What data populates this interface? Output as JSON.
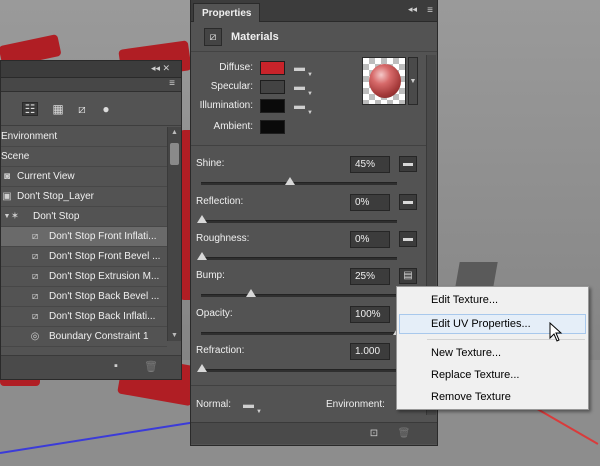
{
  "scene": {
    "red": "#b01e24",
    "floor_axis_blue": "#3b3bd9",
    "floor_axis_red": "#d93b3b"
  },
  "panel3d": {
    "controls": "◂◂ ✕",
    "menu_icon": "≡",
    "tree": [
      {
        "label": "Environment",
        "icon": "none",
        "indent": 0
      },
      {
        "label": "Scene",
        "icon": "none",
        "indent": 0
      },
      {
        "label": "Current View",
        "icon": "camera-icon",
        "indent": 1
      },
      {
        "label": "Don't Stop_Layer",
        "icon": "mesh-icon",
        "indent": 1
      },
      {
        "label": "Don't Stop",
        "icon": "mesh-group-icon",
        "indent": 1
      },
      {
        "label": "Don't Stop Front Inflati...",
        "icon": "material-icon",
        "indent": 2,
        "selected": true
      },
      {
        "label": "Don't Stop Front Bevel ...",
        "icon": "material-icon",
        "indent": 2
      },
      {
        "label": "Don't Stop Extrusion M...",
        "icon": "material-icon",
        "indent": 2
      },
      {
        "label": "Don't Stop Back Bevel ...",
        "icon": "material-icon",
        "indent": 2
      },
      {
        "label": "Don't Stop Back Inflati...",
        "icon": "material-icon",
        "indent": 2
      },
      {
        "label": "Boundary Constraint 1",
        "icon": "constraint-icon",
        "indent": 2
      }
    ]
  },
  "properties": {
    "tab_label": "Properties",
    "menu_icon": "≡",
    "section_title": "Materials",
    "color_rows": [
      {
        "label": "Diffuse:",
        "color": "#c8232a",
        "has_folder": true
      },
      {
        "label": "Specular:",
        "color": "#434343",
        "has_folder": true
      },
      {
        "label": "Illumination:",
        "color": "#0a0a0a",
        "has_folder": true
      },
      {
        "label": "Ambient:",
        "color": "#0a0a0a",
        "has_folder": false
      }
    ],
    "sliders": [
      {
        "label": "Shine:",
        "value": "45%",
        "fraction": 0.45
      },
      {
        "label": "Reflection:",
        "value": "0%",
        "fraction": 0.0
      },
      {
        "label": "Roughness:",
        "value": "0%",
        "fraction": 0.0
      },
      {
        "label": "Bump:",
        "value": "25%",
        "fraction": 0.25
      },
      {
        "label": "Opacity:",
        "value": "100%",
        "fraction": 1.0
      },
      {
        "label": "Refraction:",
        "value": "1.000",
        "fraction": 0.0
      }
    ],
    "normal_label": "Normal:",
    "environment_label": "Environment:"
  },
  "context_menu": {
    "items": [
      {
        "label": "Edit Texture...",
        "hover": false
      },
      {
        "label": "Edit UV Properties...",
        "hover": true
      },
      {
        "label": "New Texture...",
        "hover": false
      },
      {
        "label": "Replace Texture...",
        "hover": false
      },
      {
        "label": "Remove Texture",
        "hover": false
      }
    ]
  }
}
